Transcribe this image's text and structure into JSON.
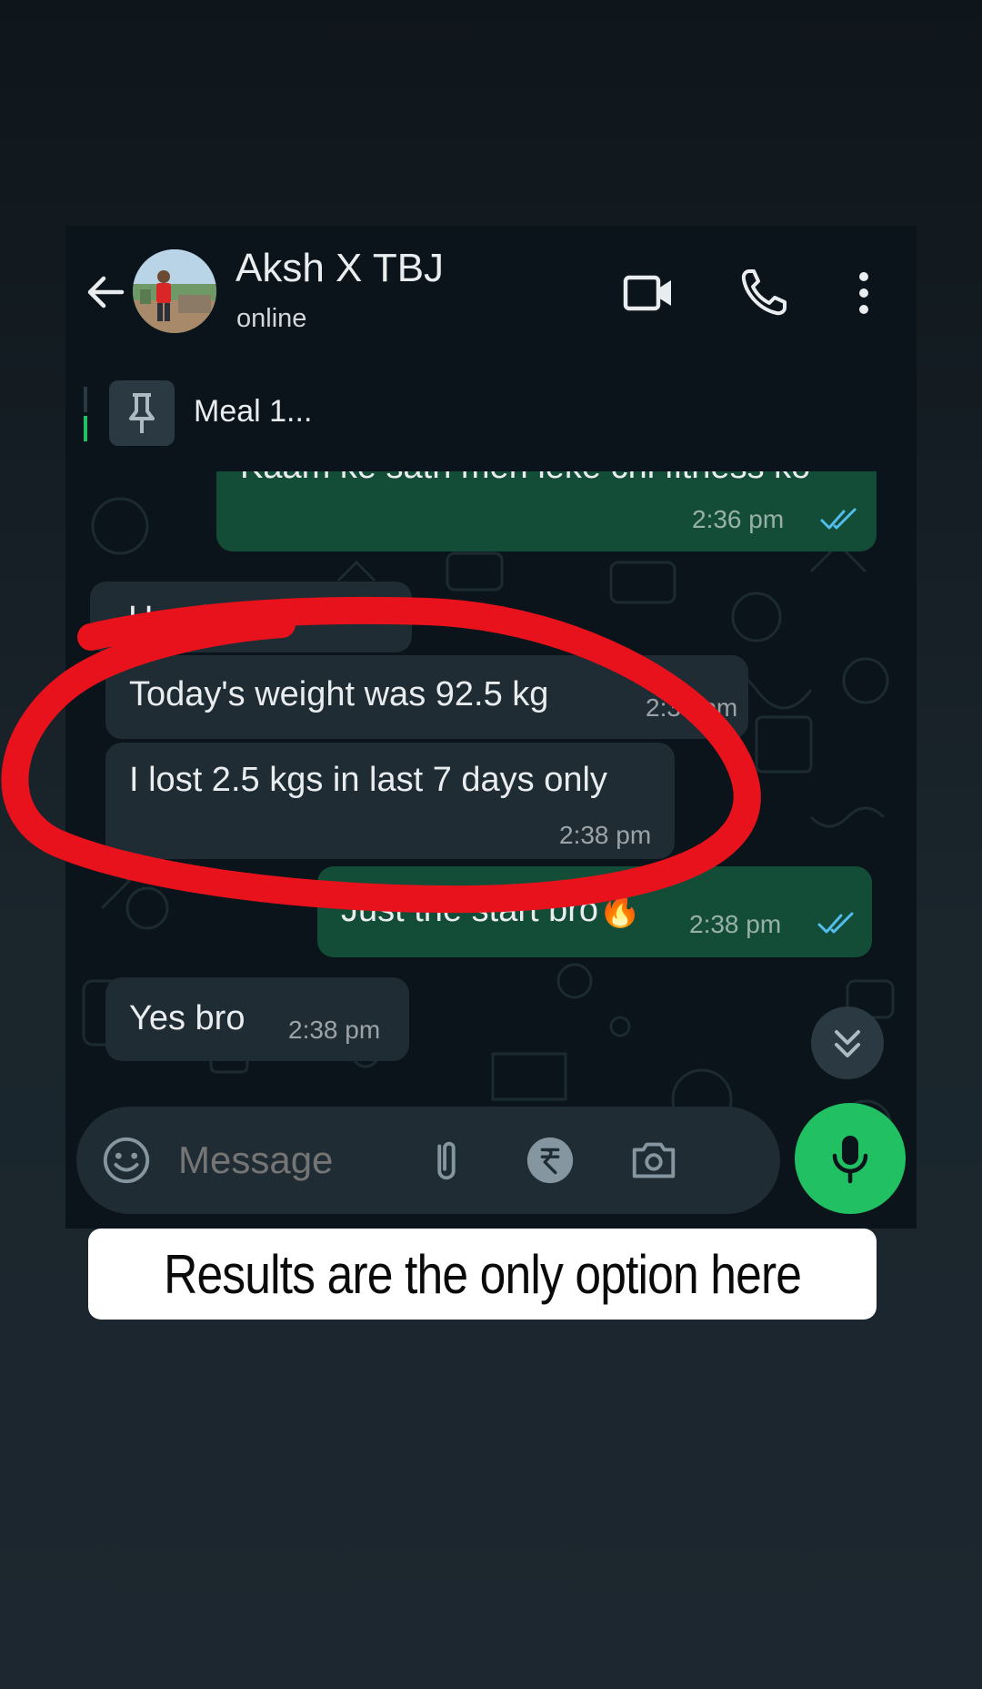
{
  "header": {
    "title": "Aksh X TBJ",
    "status": "online",
    "icons": [
      "back-arrow-icon",
      "video-call-icon",
      "voice-call-icon",
      "more-options-icon"
    ]
  },
  "pinned": {
    "label": "Meal 1..."
  },
  "messages": [
    {
      "direction": "outgoing",
      "text": "Kaam ke sath meri leke chl fitness ko",
      "time": "2:36 pm",
      "read": true
    },
    {
      "direction": "incoming",
      "text": "Hnn bro",
      "time": ""
    },
    {
      "direction": "incoming",
      "text": "Today's weight was 92.5 kg",
      "time": "2:38 pm"
    },
    {
      "direction": "incoming",
      "text": "I lost 2.5 kgs in last 7 days only",
      "time": "2:38 pm"
    },
    {
      "direction": "outgoing",
      "text": "Just the start bro🔥",
      "time": "2:38 pm",
      "read": true
    },
    {
      "direction": "incoming",
      "text": "Yes bro",
      "time": "2:38 pm"
    }
  ],
  "composer": {
    "placeholder": "Message",
    "icons": [
      "emoji-icon",
      "attach-icon",
      "rupee-payment-icon",
      "camera-icon",
      "mic-icon"
    ]
  },
  "caption": "Results are the only option here",
  "colors": {
    "accent": "#21c063",
    "outgoing_bubble": "#144d37",
    "incoming_bubble": "#202c33",
    "header_bg": "#0b141a",
    "annotation": "#e8121d",
    "read_tick": "#53bdeb"
  }
}
